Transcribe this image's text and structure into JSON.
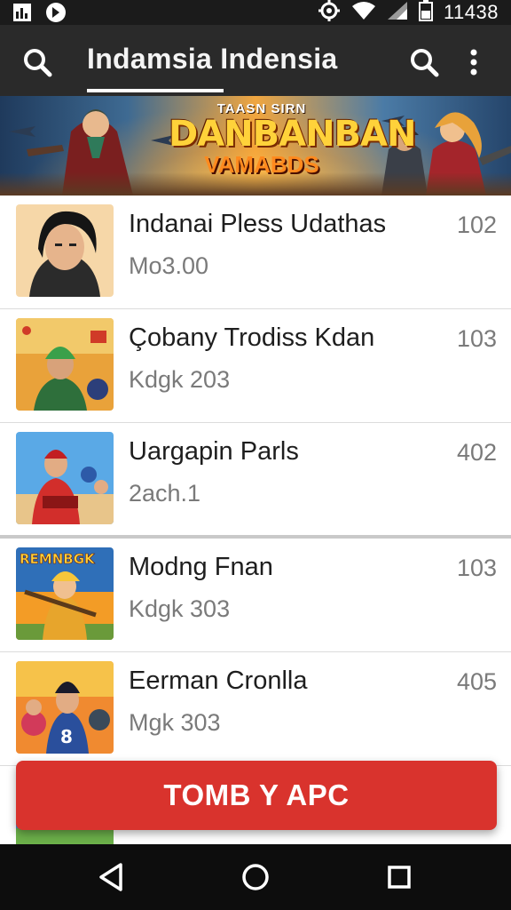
{
  "status_bar": {
    "time": "11438",
    "icons": [
      "gallery-icon",
      "notification-icon",
      "settings-icon",
      "wifi-icon",
      "signal-icon",
      "battery-icon"
    ]
  },
  "app_bar": {
    "title": "Indamsia Indensia",
    "icons": [
      "search-icon",
      "search-icon",
      "more-vert-icon"
    ]
  },
  "banner": {
    "kicker": "TAASN SIRN",
    "headline": "DANBANBAN",
    "subtitle": "VAMABDS"
  },
  "list": {
    "items": [
      {
        "title": "Indanai Pless Udathas",
        "subtitle": "Mo3.00",
        "count": "102",
        "thumb_colors": [
          "#f2c48d",
          "#2a2a2a"
        ]
      },
      {
        "title": "Çobany Trodiss Kdan",
        "subtitle": "Kdgk 203",
        "count": "103",
        "thumb_colors": [
          "#3a7a3a",
          "#d64a2f"
        ]
      },
      {
        "title": "Uargapin Parls",
        "subtitle": "2ach.1",
        "count": "402",
        "thumb_colors": [
          "#3b8fd6",
          "#d8312c"
        ]
      },
      {
        "title": "Modng Fnan",
        "subtitle": "Kdgk 303",
        "count": "103",
        "thumb_colors": [
          "#f39c26",
          "#2f6fb8"
        ],
        "thumb_text": "REMNBGK"
      },
      {
        "title": "Eerman Cronlla",
        "subtitle": "Mgk 303",
        "count": "405",
        "thumb_colors": [
          "#f08a30",
          "#2a4f9c"
        ]
      }
    ]
  },
  "cta": {
    "label": "TOMB Y APC"
  },
  "colors": {
    "accent": "#d9332d",
    "app_bar": "#2a2a2a",
    "status_bar": "#1b1b1b",
    "nav_bar": "#0d0d0d"
  }
}
